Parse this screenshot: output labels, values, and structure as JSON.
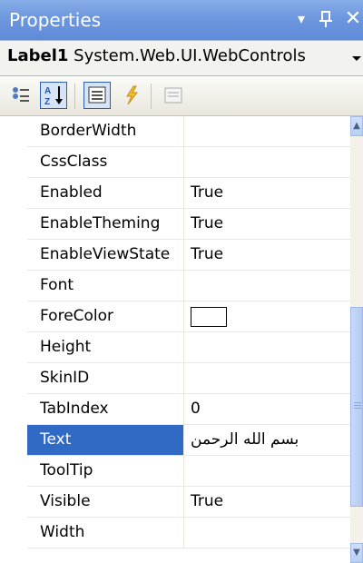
{
  "window": {
    "title": "Properties",
    "dropdown_glyph": "▾",
    "pin_glyph": "ᵾ",
    "close_glyph": "✕"
  },
  "object_selector": {
    "name": "Label1",
    "type": "System.Web.UI.WebControls"
  },
  "toolbar": {
    "buttons": [
      {
        "icon": "categorized-icon",
        "active": false
      },
      {
        "icon": "alphabetical-sort-icon",
        "active": true
      },
      {
        "icon": "properties-icon",
        "active": true
      },
      {
        "icon": "events-lightning-icon",
        "active": false
      },
      {
        "icon": "property-pages-icon",
        "active": false
      }
    ]
  },
  "properties": [
    {
      "name": "BorderWidth",
      "value": ""
    },
    {
      "name": "CssClass",
      "value": ""
    },
    {
      "name": "Enabled",
      "value": "True"
    },
    {
      "name": "EnableTheming",
      "value": "True"
    },
    {
      "name": "EnableViewState",
      "value": "True"
    },
    {
      "name": "Font",
      "value": "",
      "expandable": true,
      "expander": "+"
    },
    {
      "name": "ForeColor",
      "value": "",
      "swatch_color": "#ffffff"
    },
    {
      "name": "Height",
      "value": ""
    },
    {
      "name": "SkinID",
      "value": ""
    },
    {
      "name": "TabIndex",
      "value": "0"
    },
    {
      "name": "Text",
      "value": "بسم الله الرحمن",
      "selected": true
    },
    {
      "name": "ToolTip",
      "value": ""
    },
    {
      "name": "Visible",
      "value": "True"
    },
    {
      "name": "Width",
      "value": ""
    }
  ],
  "colors": {
    "titlebar": "#6d98de",
    "selection": "#316ac5",
    "grid_line": "#ece9d8"
  }
}
